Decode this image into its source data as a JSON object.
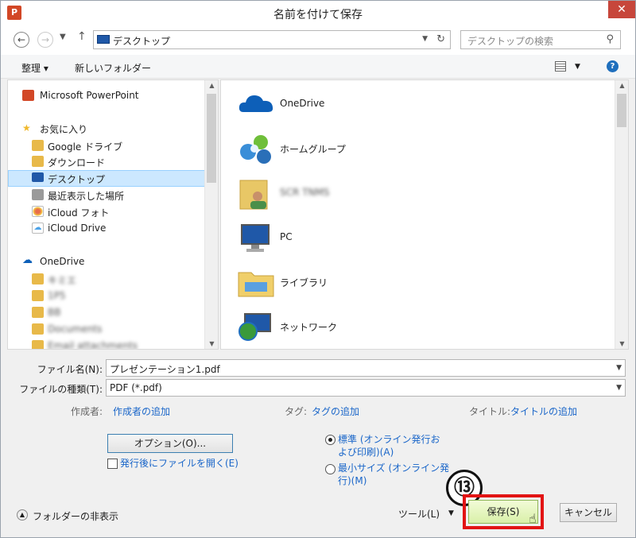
{
  "window": {
    "title": "名前を付けて保存",
    "app_icon": "P"
  },
  "nav": {
    "back_icon": "←",
    "forward_icon": "→",
    "up_icon": "↑",
    "address": "デスクトップ",
    "search_placeholder": "デスクトップの検索"
  },
  "toolbar": {
    "organize": "整理 ▾",
    "new_folder": "新しいフォルダー"
  },
  "sidebar": {
    "items": [
      {
        "label": "Microsoft PowerPoint",
        "icon": "powerpoint-icon",
        "color": "#d24726"
      },
      {
        "label": "お気に入り",
        "icon": "star-icon",
        "color": "#f0b82b"
      },
      {
        "label": "Google ドライブ",
        "icon": "google-drive-folder-icon",
        "color": "#e8b949"
      },
      {
        "label": "ダウンロード",
        "icon": "download-folder-icon",
        "color": "#e8b949"
      },
      {
        "label": "デスクトップ",
        "icon": "desktop-icon",
        "color": "#1f58a8"
      },
      {
        "label": "最近表示した場所",
        "icon": "recent-places-icon",
        "color": "#8a8a8a"
      },
      {
        "label": "iCloud フォト",
        "icon": "icloud-photos-icon",
        "color": "#e86c4a"
      },
      {
        "label": "iCloud Drive",
        "icon": "icloud-drive-icon",
        "color": "#4da3e8"
      },
      {
        "label": "OneDrive",
        "icon": "onedrive-icon",
        "color": "#0d5fb8"
      },
      {
        "label": "キミエ",
        "icon": "folder-icon",
        "color": "#e8b949"
      },
      {
        "label": "1P5",
        "icon": "folder-icon",
        "color": "#e8b949"
      },
      {
        "label": "BB",
        "icon": "folder-icon",
        "color": "#e8b949"
      },
      {
        "label": "Documents",
        "icon": "folder-icon",
        "color": "#e8b949"
      },
      {
        "label": "Email attachments",
        "icon": "folder-icon",
        "color": "#e8b949"
      }
    ]
  },
  "content": {
    "items": [
      {
        "label": "OneDrive",
        "icon": "onedrive-cloud-icon"
      },
      {
        "label": "ホームグループ",
        "icon": "homegroup-icon"
      },
      {
        "label": "SCR TNMS",
        "icon": "user-folder-icon"
      },
      {
        "label": "PC",
        "icon": "computer-icon"
      },
      {
        "label": "ライブラリ",
        "icon": "library-folder-icon"
      },
      {
        "label": "ネットワーク",
        "icon": "network-icon"
      }
    ]
  },
  "form": {
    "filename_label": "ファイル名(N):",
    "filename_value": "プレゼンテーション1.pdf",
    "filetype_label": "ファイルの種類(T):",
    "filetype_value": "PDF (*.pdf)",
    "author_label": "作成者:",
    "author_link": "作成者の追加",
    "tags_label": "タグ:",
    "tags_link": "タグの追加",
    "title_label": "タイトル:",
    "title_link": "タイトルの追加",
    "options_button": "オプション(O)...",
    "open_after_label": "発行後にファイルを開く(E)",
    "radio_standard_line1": "標準 (オンライン発行お",
    "radio_standard_line2": "よび印刷)(A)",
    "radio_min_line1": "最小サイズ (オンライン発",
    "radio_min_line2": "行)(M)"
  },
  "footer": {
    "hide_folders": "フォルダーの非表示",
    "tools": "ツール(L)",
    "save": "保存(S)",
    "cancel": "キャンセル",
    "callout": "⑬"
  },
  "colors": {
    "highlight": "#e21414",
    "link": "#1a66c9",
    "selection": "#cce8ff"
  }
}
